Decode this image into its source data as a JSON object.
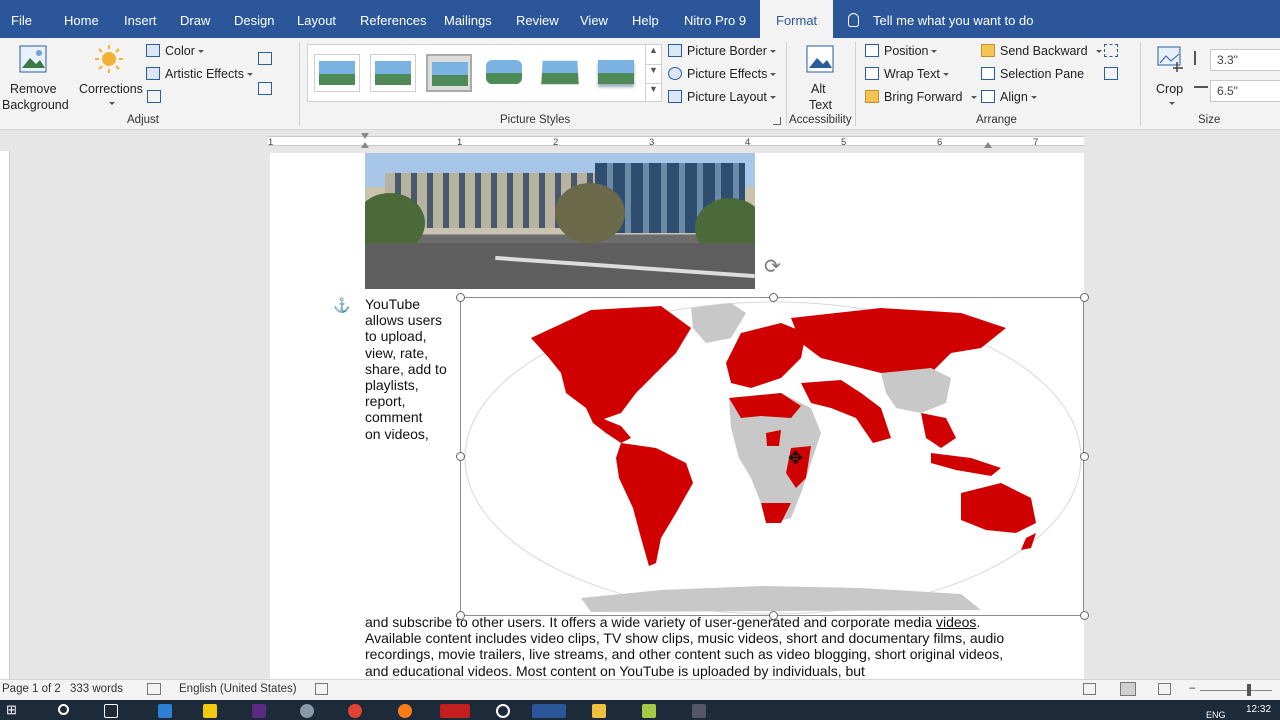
{
  "tabs": [
    {
      "label": "File"
    },
    {
      "label": "Home"
    },
    {
      "label": "Insert"
    },
    {
      "label": "Draw"
    },
    {
      "label": "Design"
    },
    {
      "label": "Layout"
    },
    {
      "label": "References"
    },
    {
      "label": "Mailings"
    },
    {
      "label": "Review"
    },
    {
      "label": "View"
    },
    {
      "label": "Help"
    },
    {
      "label": "Nitro Pro 9"
    },
    {
      "label": "Format"
    }
  ],
  "tell_me": "Tell me what you want to do",
  "ribbon": {
    "adjust": {
      "remove_background_line1": "Remove",
      "remove_background_line2": "Background",
      "corrections": "Corrections",
      "color": "Color",
      "artistic_effects": "Artistic Effects",
      "group_label": "Adjust"
    },
    "picture_styles": {
      "picture_border": "Picture Border",
      "picture_effects": "Picture Effects",
      "picture_layout": "Picture Layout",
      "group_label": "Picture Styles"
    },
    "accessibility": {
      "alt_text_line1": "Alt",
      "alt_text_line2": "Text",
      "group_label": "Accessibility"
    },
    "arrange": {
      "position": "Position",
      "wrap_text": "Wrap Text",
      "bring_forward": "Bring Forward",
      "send_backward": "Send Backward",
      "selection_pane": "Selection Pane",
      "align": "Align",
      "group_label": "Arrange"
    },
    "size": {
      "crop": "Crop",
      "height": "3.3\"",
      "width": "6.5\"",
      "group_label": "Size"
    }
  },
  "ruler": [
    "1",
    "1",
    "2",
    "3",
    "4",
    "5",
    "6",
    "7"
  ],
  "document": {
    "wrap_lines": [
      "YouTube",
      "allows users",
      "to upload,",
      "view, rate,",
      "share, add to",
      "playlists,",
      "report,",
      "comment",
      "on videos,"
    ],
    "body_before": "and subscribe to other users. It offers a wide variety of user-generated and corporate media ",
    "body_link": "videos",
    "body_after": ". Available content includes video clips, TV show clips, music videos, short and documentary films, audio recordings, movie trailers, live streams, and other content such as video blogging, short original videos, and educational videos. Most content on YouTube is uploaded by individuals, but"
  },
  "status": {
    "page": "Page 1 of 2",
    "words": "333 words",
    "language": "English (United States)"
  },
  "taskbar": {
    "lang": "ENG",
    "clock": "12:32"
  },
  "colors": {
    "ribbon_blue": "#2b579a",
    "map_red": "#d10000",
    "map_gray": "#c8c8c8"
  }
}
